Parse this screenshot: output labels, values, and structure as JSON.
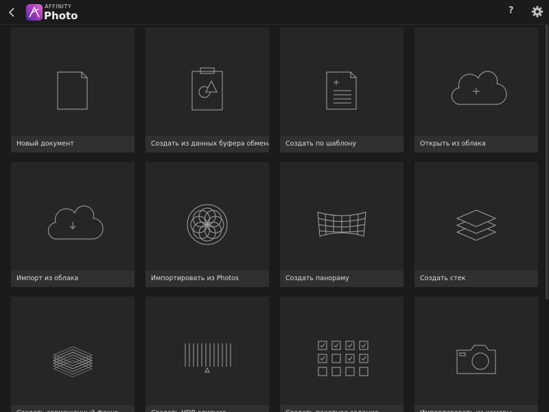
{
  "header": {
    "brand_top": "AFFINITY",
    "brand_name": "Photo",
    "help_label": "?",
    "icons": {
      "back": "chevron-left-icon",
      "logo": "affinity-photo-logo",
      "settings": "gear-icon"
    },
    "logo_colors": [
      "#4a2f9e",
      "#b240c0",
      "#e070d0"
    ]
  },
  "tiles": [
    {
      "label": "Новый документ",
      "icon": "blank-document-icon"
    },
    {
      "label": "Создать из данных буфера обмена",
      "icon": "clipboard-icon"
    },
    {
      "label": "Создать по шаблону",
      "icon": "template-document-icon"
    },
    {
      "label": "Открыть из облака",
      "icon": "cloud-plus-icon"
    },
    {
      "label": "Импорт из облака",
      "icon": "cloud-download-icon"
    },
    {
      "label": "Импортировать из Photos",
      "icon": "photos-flower-icon"
    },
    {
      "label": "Создать панораму",
      "icon": "panorama-icon"
    },
    {
      "label": "Создать стек",
      "icon": "layers-stack-icon"
    },
    {
      "label": "Создать совмещенный фокус",
      "icon": "focus-merge-icon"
    },
    {
      "label": "Создать HDR-слияние",
      "icon": "hdr-merge-icon"
    },
    {
      "label": "Создать пакетное задание",
      "icon": "batch-job-icon"
    },
    {
      "label": "Импортировать из камеры",
      "icon": "camera-icon"
    }
  ]
}
